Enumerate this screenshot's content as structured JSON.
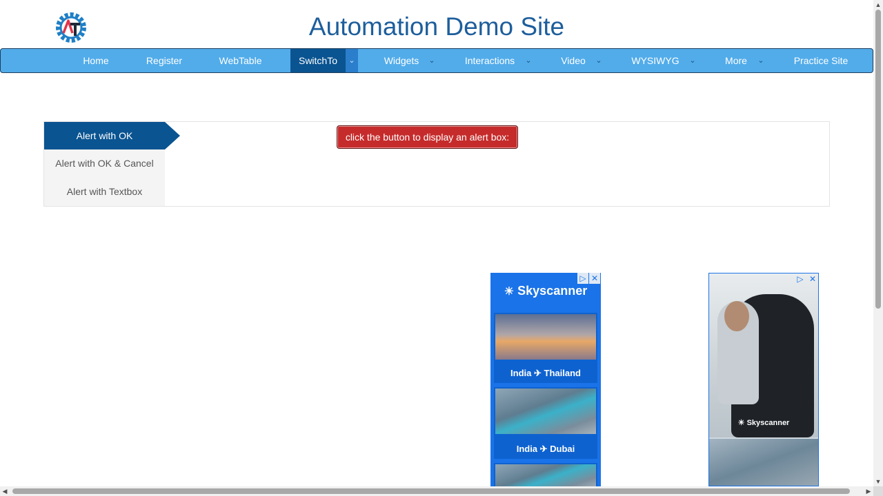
{
  "header": {
    "title": "Automation Demo Site",
    "logo_icon": "gear-logo-icon"
  },
  "nav": {
    "items": [
      {
        "label": "Home"
      },
      {
        "label": "Register"
      },
      {
        "label": "WebTable"
      },
      {
        "label": "SwitchTo",
        "active": true,
        "caret": "⌄"
      },
      {
        "label": "Widgets",
        "caret": "⌄"
      },
      {
        "label": "Interactions",
        "caret": "⌄"
      },
      {
        "label": "Video",
        "caret": "⌄"
      },
      {
        "label": "WYSIWYG",
        "caret": "⌄"
      },
      {
        "label": "More",
        "caret": "⌄"
      },
      {
        "label": "Practice Site"
      }
    ]
  },
  "tabs": [
    {
      "label": "Alert with OK",
      "active": true
    },
    {
      "label": "Alert with OK & Cancel"
    },
    {
      "label": "Alert with Textbox"
    }
  ],
  "alert_button": {
    "label": "click the button to display an alert box:"
  },
  "ads": {
    "left": {
      "brand": "Skyscanner",
      "cards": [
        {
          "label": "India ✈ Thailand"
        },
        {
          "label": "India ✈ Dubai"
        }
      ],
      "ad_choices": "▷",
      "close": "✕"
    },
    "right": {
      "brand": "Skyscanner",
      "ad_choices": "▷",
      "close": "✕"
    }
  },
  "scrollbars": {
    "up": "▲",
    "down": "▼",
    "left": "◀",
    "right": "▶"
  },
  "colors": {
    "brand_blue": "#1d5e9c",
    "nav_bg": "#52acea",
    "nav_active": "#0a5491",
    "alert_red": "#c62b2b"
  }
}
